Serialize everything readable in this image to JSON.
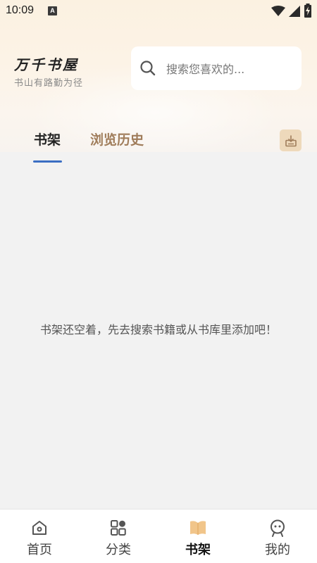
{
  "status_bar": {
    "time": "10:09",
    "notification_letter": "A"
  },
  "header": {
    "logo_title": "万千书屋",
    "logo_subtitle": "书山有路勤为径",
    "search_placeholder": "搜索您喜欢的..."
  },
  "tabs": [
    {
      "label": "书架",
      "active": true
    },
    {
      "label": "浏览历史",
      "active": false
    }
  ],
  "empty_state": {
    "message": "书架还空着，先去搜索书籍或从书库里添加吧！"
  },
  "bottom_nav": [
    {
      "label": "首页",
      "icon": "home-icon",
      "active": false
    },
    {
      "label": "分类",
      "icon": "category-icon",
      "active": false
    },
    {
      "label": "书架",
      "icon": "book-icon",
      "active": true
    },
    {
      "label": "我的",
      "icon": "profile-icon",
      "active": false
    }
  ],
  "colors": {
    "accent_tab_underline": "#3b6ec3",
    "history_tab": "#a07d5b",
    "download_btn_bg": "#eed9bb",
    "active_nav_icon": "#f1c58a"
  }
}
